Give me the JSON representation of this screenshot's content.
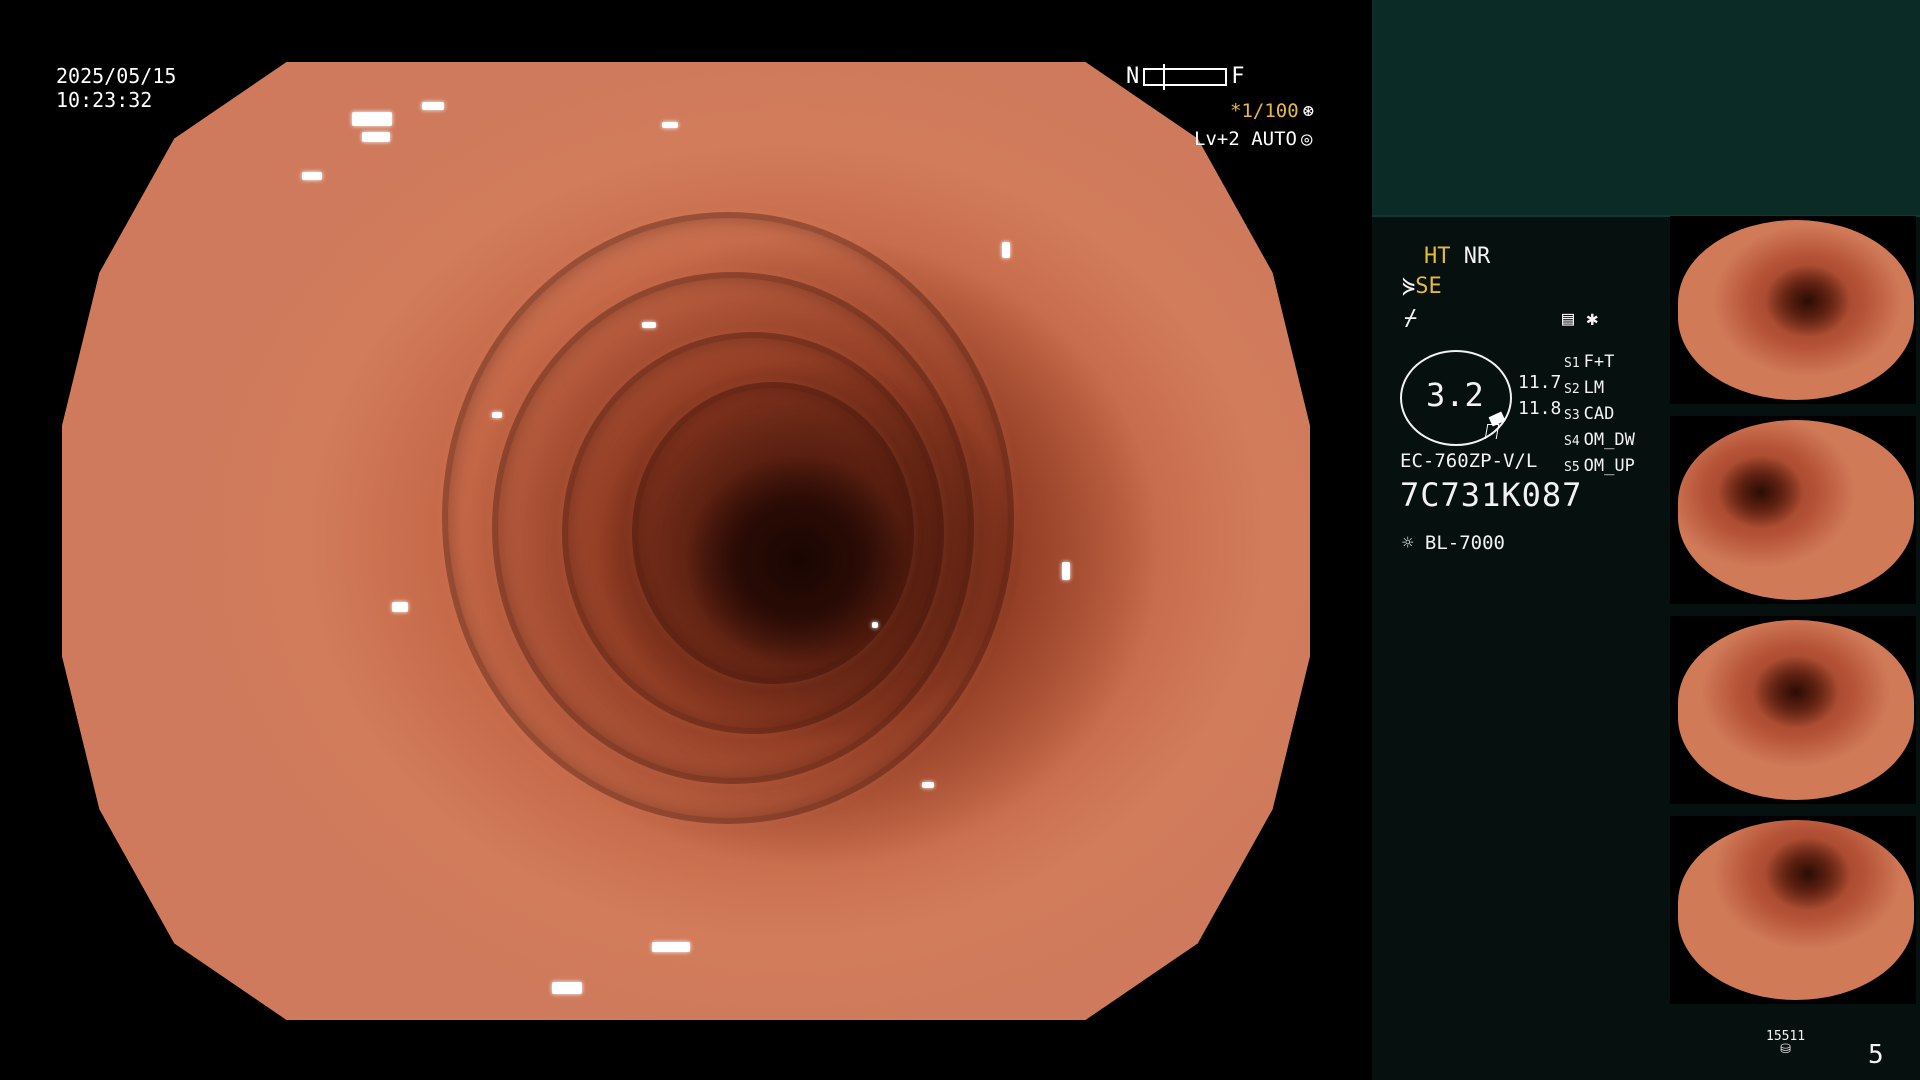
{
  "overlay": {
    "date": "2025/05/15",
    "time": "10:23:32",
    "near_label": "N",
    "far_label": "F",
    "shutter": "*1/100",
    "shutter_icon": "⊛",
    "level": "Lv+2 AUTO",
    "level_icon": "◎"
  },
  "panel": {
    "ht": "HT",
    "nr": "NR",
    "se": "SE",
    "se_icon": "⋟",
    "flash_icon": "⌿",
    "sub_icon": "▤ ✱",
    "zoom_value": "3.2",
    "value_1": "11.7",
    "value_2": "11.8",
    "s_settings": [
      {
        "key": "S1",
        "val": "F+T"
      },
      {
        "key": "S2",
        "val": "LM"
      },
      {
        "key": "S3",
        "val": "CAD"
      },
      {
        "key": "S4",
        "val": "OM_DW"
      },
      {
        "key": "S5",
        "val": "OM_UP"
      }
    ],
    "scope_model": "EC-760ZP-V/L",
    "scope_serial": "7C731K087",
    "light_source": "BL-7000",
    "light_icon": "☼",
    "counter": "15511",
    "counter_icon": "⛁",
    "page_number": "5"
  },
  "thumbnails": [
    {
      "name": "thumbnail-1"
    },
    {
      "name": "thumbnail-2"
    },
    {
      "name": "thumbnail-3"
    },
    {
      "name": "thumbnail-4"
    }
  ],
  "colors": {
    "accent_yellow": "#e6b83e",
    "panel_bg": "#06100f",
    "panel_top_bg": "#0b2b27"
  }
}
